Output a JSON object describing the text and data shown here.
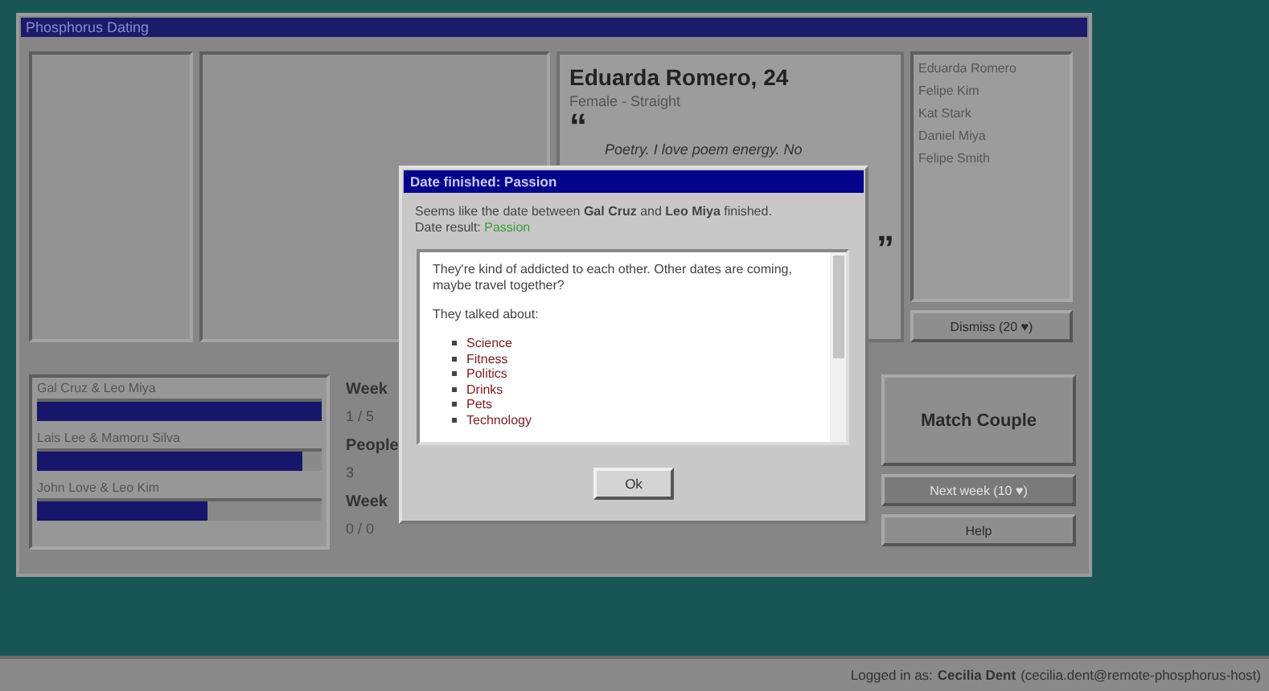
{
  "window": {
    "title": "Phosphorus Dating"
  },
  "profile": {
    "name": "Eduarda Romero, 24",
    "subtitle": "Female - Straight",
    "open_quote": "“",
    "bio": "Poetry. I love poem energy. No",
    "close_quote": "”"
  },
  "people": [
    {
      "name": "Eduarda Romero"
    },
    {
      "name": "Felipe Kim"
    },
    {
      "name": "Kat Stark"
    },
    {
      "name": "Daniel Miya"
    },
    {
      "name": "Felipe Smith"
    }
  ],
  "dismiss_button": "Dismiss (20 ♥)",
  "couples": [
    {
      "names": "Gal Cruz & Leo Miya",
      "level": 1
    },
    {
      "names": "Lais Lee & Mamoru Silva",
      "level": 0.93
    },
    {
      "names": "John Love & Leo Kim",
      "level": 0.6
    }
  ],
  "stats": [
    {
      "label": "Week",
      "value": "1 / 5"
    },
    {
      "label": "People",
      "value": "3"
    },
    {
      "label": "Week",
      "value": "0 / 0"
    }
  ],
  "buttons": [
    {
      "label": "Match Couple",
      "kind": "primary",
      "disabled": false
    },
    {
      "label": "Next week (10 ♥)",
      "kind": "normal",
      "disabled": true
    },
    {
      "label": "Help",
      "kind": "normal",
      "disabled": false
    }
  ],
  "dialog": {
    "title": "Date finished: Passion",
    "message": "Seems like the date between **Gal Cruz** and **Leo Miya** finished.",
    "result_label": "Date result:",
    "result": "Passion",
    "description": "They're kind of addicted to each other. Other dates are coming, maybe travel together?",
    "topics_intro": "They talked about:",
    "topics": [
      "Science",
      "Fitness",
      "Politics",
      "Drinks",
      "Pets",
      "Technology"
    ],
    "ok_button": "Ok"
  },
  "status_bar": {
    "label": "Logged in as:",
    "user": "Cecilia Dent",
    "email": "(cecilia.dent@remote-phosphorus-host)"
  }
}
